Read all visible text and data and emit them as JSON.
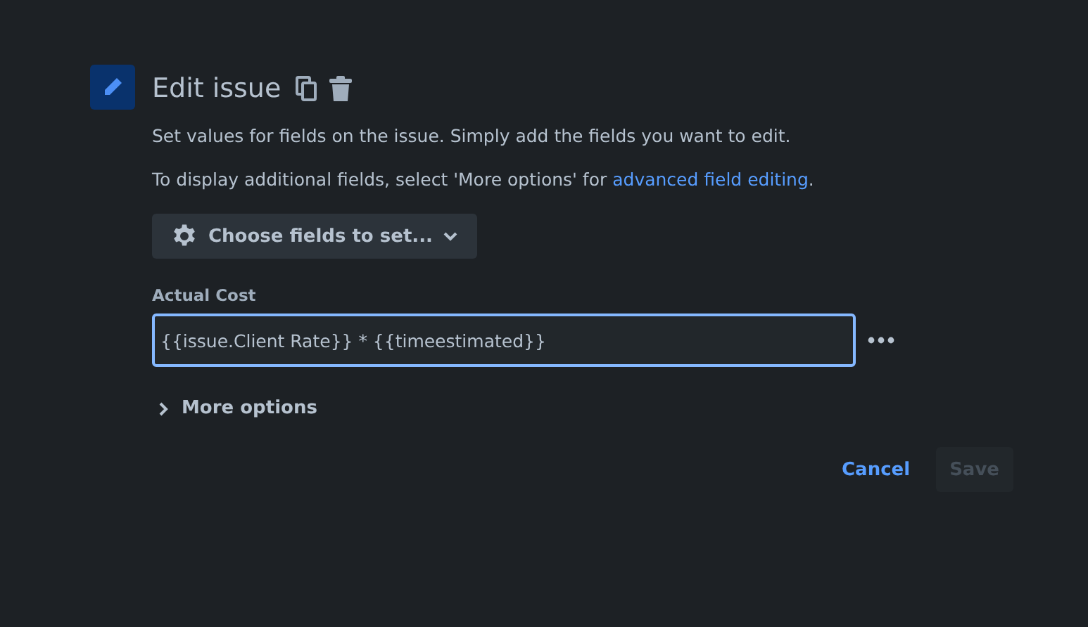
{
  "header": {
    "title": "Edit issue"
  },
  "description": "Set values for fields on the issue. Simply add the fields you want to edit.",
  "hint": {
    "text": "To display additional fields, select 'More options' for ",
    "link": "advanced field editing",
    "after": "."
  },
  "choose_button": {
    "label": "Choose fields to set..."
  },
  "field": {
    "label": "Actual Cost",
    "value": "{{issue.Client Rate}} * {{timeestimated}}",
    "focused": true
  },
  "more_options": {
    "label": "More options",
    "expanded": false
  },
  "actions": [
    {
      "label": "Cancel",
      "kind": "link",
      "disabled": false
    },
    {
      "label": "Save",
      "kind": "button",
      "disabled": true
    }
  ]
}
